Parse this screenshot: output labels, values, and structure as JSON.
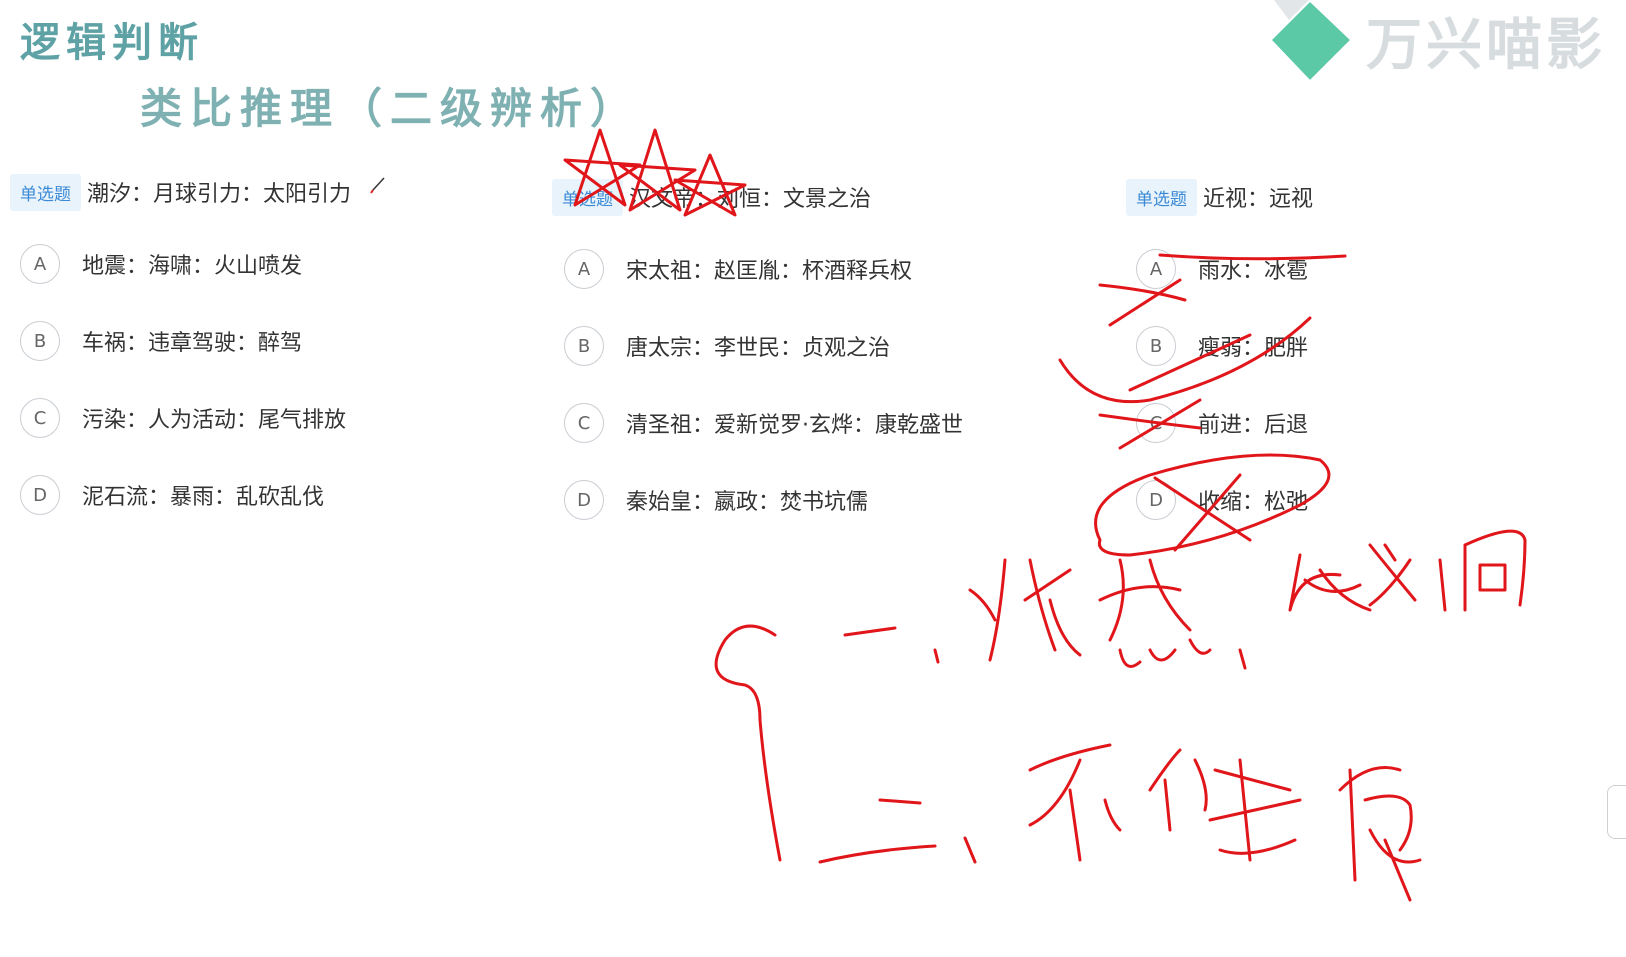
{
  "header": {
    "title": "逻辑判断",
    "subtitle": "类比推理（二级辨析）"
  },
  "watermark": {
    "brand_text": "万兴喵影",
    "logo_color": "#5bc8a6"
  },
  "questions": [
    {
      "badge": "单选题",
      "stem": "潮汐：月球引力：太阳引力",
      "options": [
        {
          "letter": "A",
          "text": "地震：海啸：火山喷发"
        },
        {
          "letter": "B",
          "text": "车祸：违章驾驶：醉驾"
        },
        {
          "letter": "C",
          "text": "污染：人为活动：尾气排放"
        },
        {
          "letter": "D",
          "text": "泥石流：暴雨：乱砍乱伐"
        }
      ]
    },
    {
      "badge": "单选题",
      "stem": "汉文帝：刘恒：文景之治",
      "options": [
        {
          "letter": "A",
          "text": "宋太祖：赵匡胤：杯酒释兵权"
        },
        {
          "letter": "B",
          "text": "唐太宗：李世民：贞观之治"
        },
        {
          "letter": "C",
          "text": "清圣祖：爱新觉罗·玄烨：康乾盛世"
        },
        {
          "letter": "D",
          "text": "秦始皇：嬴政：焚书坑儒"
        }
      ]
    },
    {
      "badge": "单选题",
      "stem": "近视：远视",
      "options": [
        {
          "letter": "A",
          "text": "雨水：冰雹"
        },
        {
          "letter": "B",
          "text": "瘦弱：肥胖"
        },
        {
          "letter": "C",
          "text": "前进：后退"
        },
        {
          "letter": "D",
          "text": "收缩：松弛"
        }
      ]
    }
  ],
  "colors": {
    "title": "#5fa2a6",
    "badge_text": "#3b8ad6",
    "badge_bg": "#e9f3fb",
    "ink": "#e0161b"
  }
}
